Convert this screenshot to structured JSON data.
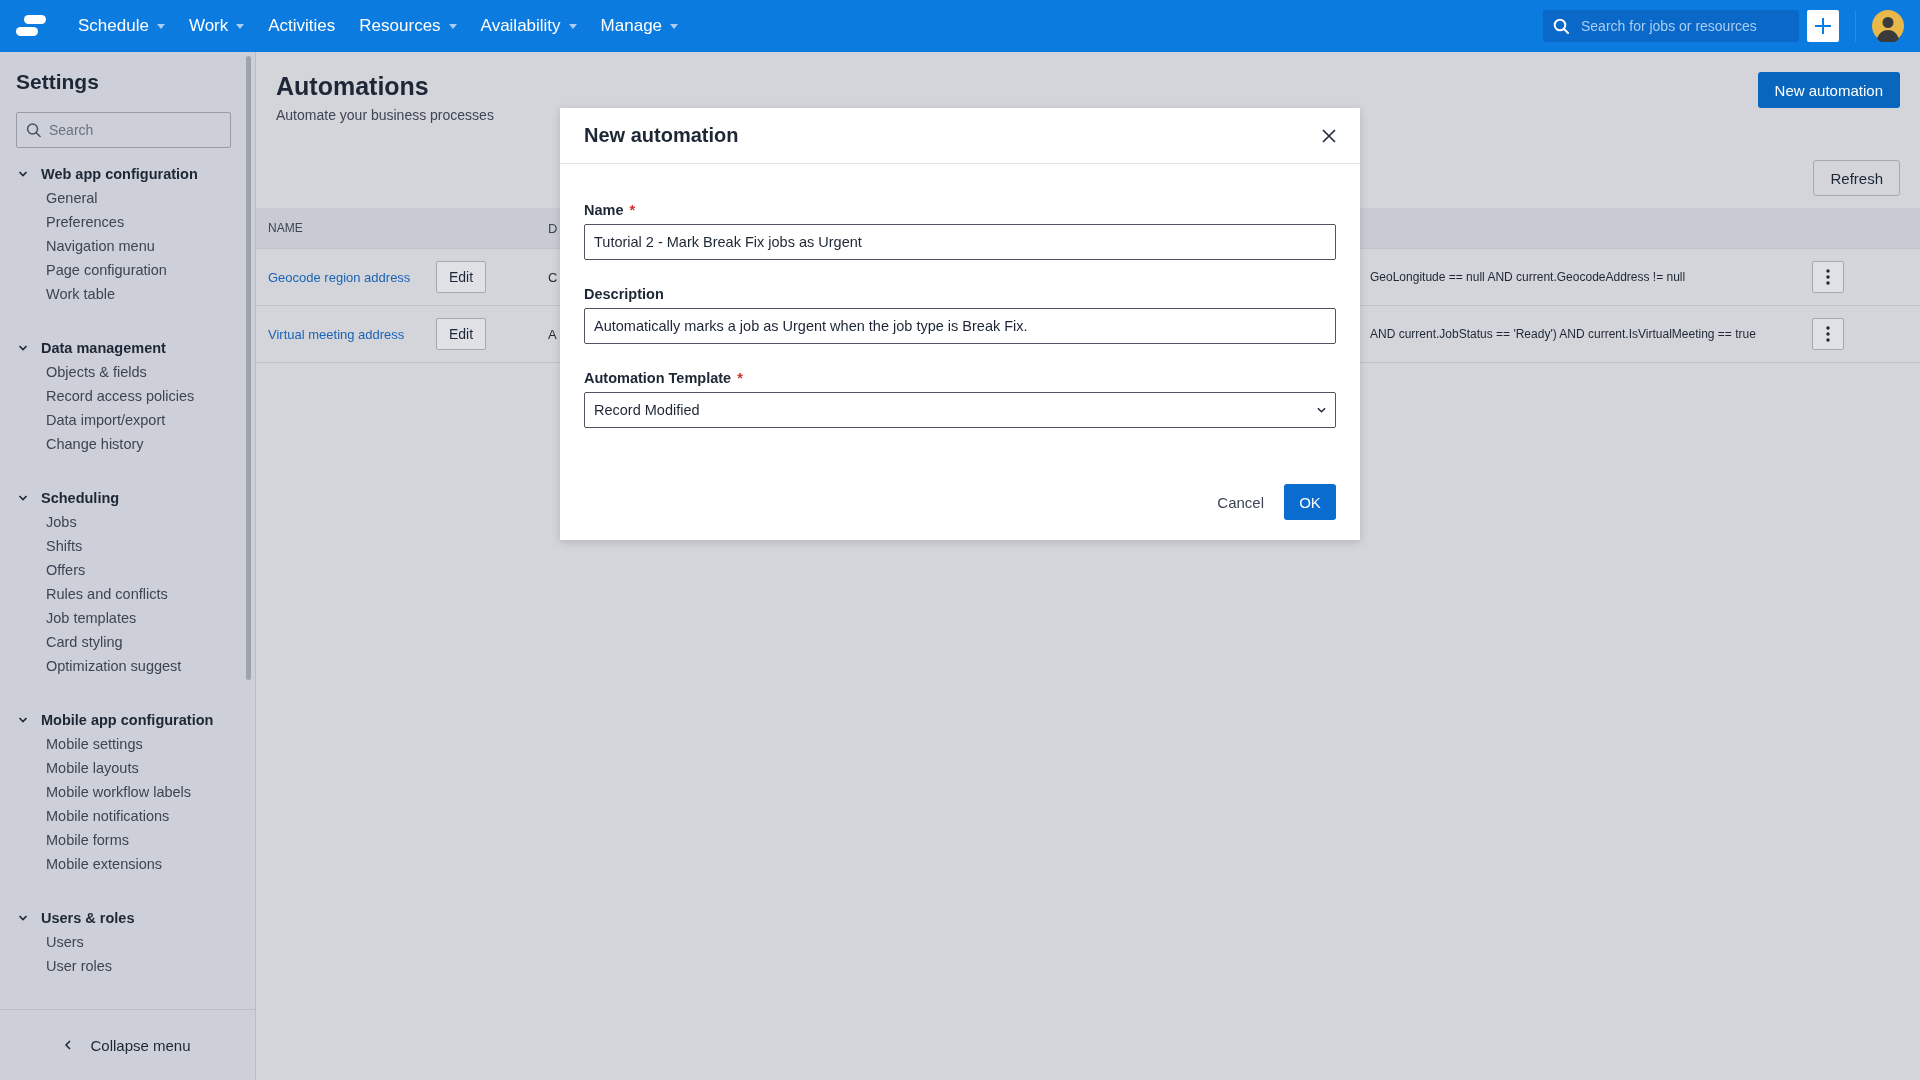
{
  "nav": {
    "items": [
      {
        "label": "Schedule",
        "dropdown": true
      },
      {
        "label": "Work",
        "dropdown": true
      },
      {
        "label": "Activities",
        "dropdown": false
      },
      {
        "label": "Resources",
        "dropdown": true
      },
      {
        "label": "Availability",
        "dropdown": true
      },
      {
        "label": "Manage",
        "dropdown": true
      }
    ],
    "search": {
      "placeholder": "Search for jobs or resources"
    }
  },
  "sidebar": {
    "title": "Settings",
    "search": {
      "placeholder": "Search"
    },
    "groups": [
      {
        "label": "Web app configuration",
        "expanded": true,
        "children": [
          {
            "label": "General"
          },
          {
            "label": "Preferences"
          },
          {
            "label": "Navigation menu"
          },
          {
            "label": "Page configuration"
          },
          {
            "label": "Work table"
          }
        ]
      },
      {
        "label": "Data management",
        "expanded": true,
        "children": [
          {
            "label": "Objects & fields"
          },
          {
            "label": "Record access policies"
          },
          {
            "label": "Data import/export"
          },
          {
            "label": "Change history"
          }
        ]
      },
      {
        "label": "Scheduling",
        "expanded": true,
        "children": [
          {
            "label": "Jobs"
          },
          {
            "label": "Shifts"
          },
          {
            "label": "Offers"
          },
          {
            "label": "Rules and conflicts"
          },
          {
            "label": "Job templates"
          },
          {
            "label": "Card styling"
          },
          {
            "label": "Optimization suggest"
          }
        ]
      },
      {
        "label": "Mobile app configuration",
        "expanded": true,
        "children": [
          {
            "label": "Mobile settings"
          },
          {
            "label": "Mobile layouts"
          },
          {
            "label": "Mobile workflow labels"
          },
          {
            "label": "Mobile notifications"
          },
          {
            "label": "Mobile forms"
          },
          {
            "label": "Mobile extensions"
          }
        ]
      },
      {
        "label": "Users & roles",
        "expanded": true,
        "children": [
          {
            "label": "Users"
          },
          {
            "label": "User roles"
          }
        ]
      }
    ],
    "collapse": "Collapse menu"
  },
  "page": {
    "title": "Automations",
    "subtitle": "Automate your business processes",
    "new_button": "New automation",
    "refresh_button": "Refresh",
    "table": {
      "columns": [
        "NAME",
        "D"
      ],
      "rows": [
        {
          "name": "Geocode region address",
          "edit": "Edit",
          "column_2": "C",
          "condition": "GeoLongitude == null AND current.GeocodeAddress != null"
        },
        {
          "name": "Virtual meeting address",
          "edit": "Edit",
          "column_2": "A",
          "condition": "AND current.JobStatus == 'Ready') AND current.IsVirtualMeeting == true"
        }
      ]
    }
  },
  "dialog": {
    "title": "New automation",
    "fields": [
      {
        "label": "Name",
        "required_mark": "*",
        "kind": "text",
        "value": "Tutorial 2 - Mark Break Fix jobs as Urgent"
      },
      {
        "label": "Description",
        "kind": "text",
        "value": "Automatically marks a job as Urgent when the job type is Break Fix."
      },
      {
        "label": "Automation Template",
        "required_mark": "*",
        "kind": "select",
        "value": "Record Modified"
      }
    ],
    "buttons": [
      {
        "label": "Cancel",
        "kind": "secondary"
      },
      {
        "label": "OK",
        "kind": "primary"
      }
    ]
  }
}
